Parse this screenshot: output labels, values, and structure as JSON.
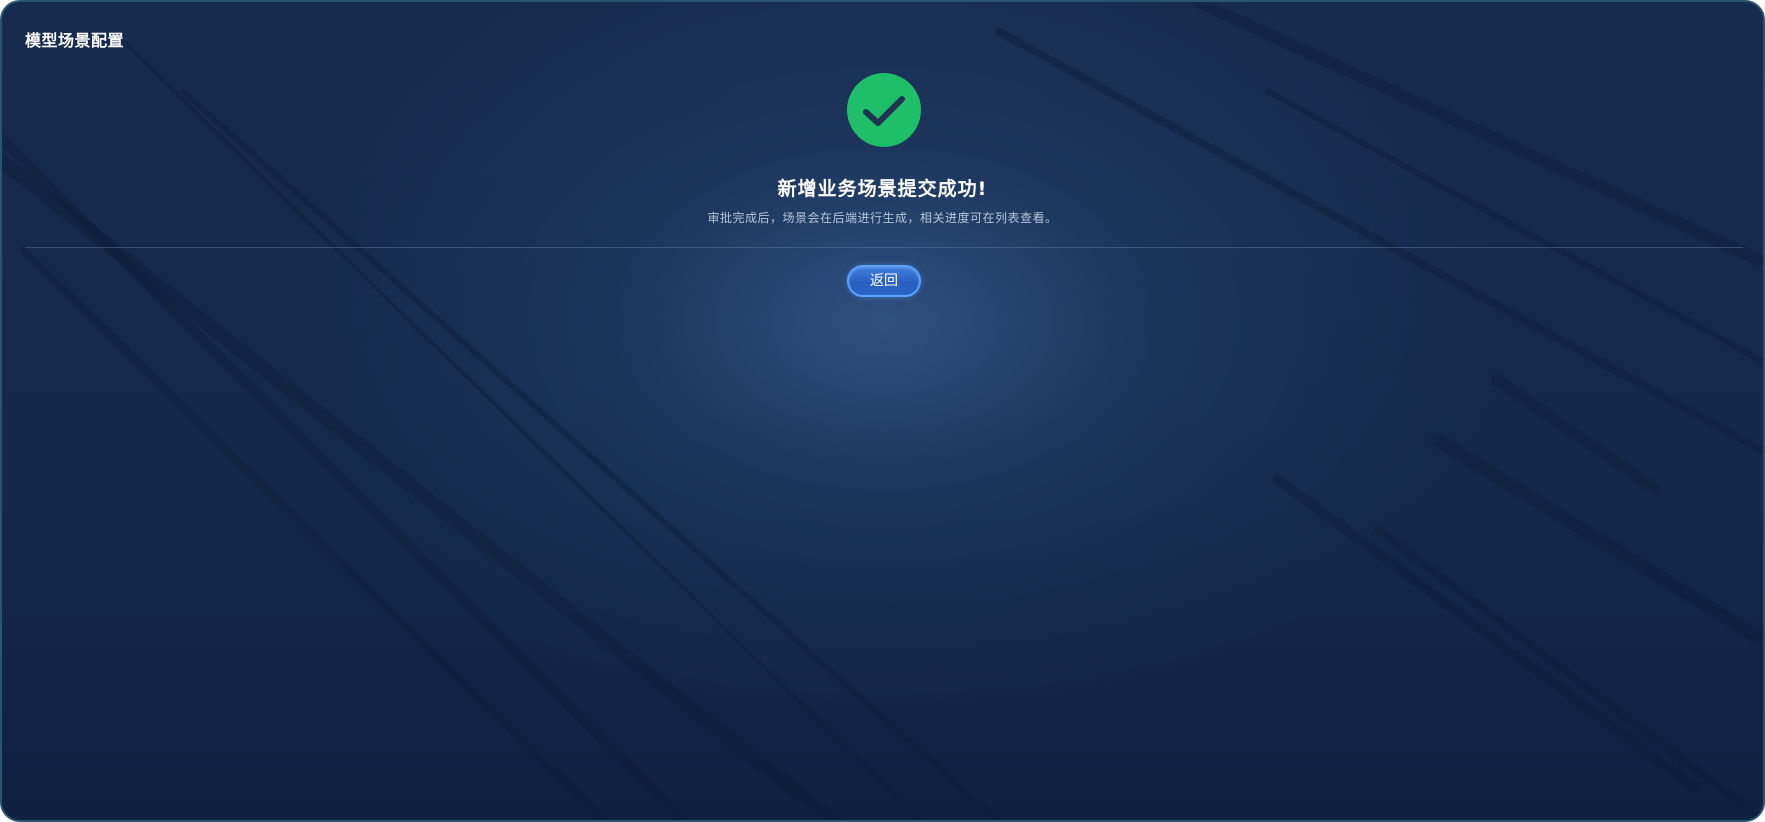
{
  "page": {
    "title": "模型场景配置"
  },
  "result": {
    "icon": "check-circle-icon",
    "icon_color": "#1fbf6a",
    "headline": "新增业务场景提交成功!",
    "description": "审批完成后，场景会在后端进行生成，相关进度可在列表查看。"
  },
  "actions": {
    "back_label": "返回"
  },
  "colors": {
    "background": "#172b4e",
    "accent": "#3e7fe0",
    "success": "#1fbf6a"
  }
}
